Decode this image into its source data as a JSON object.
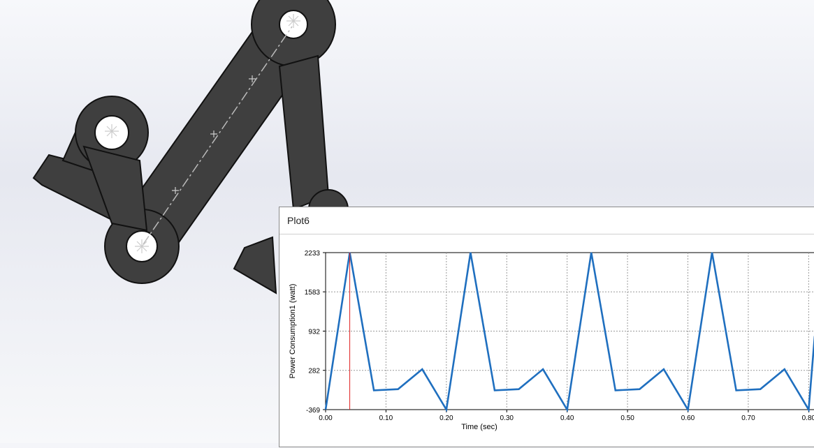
{
  "window": {
    "title": "Plot6"
  },
  "colors": {
    "series": "#1f6fbf",
    "cursor": "#e02020",
    "part": "#4a4a4a"
  },
  "chart_data": {
    "type": "line",
    "title": "",
    "xlabel": "Time (sec)",
    "ylabel": "Power Consumption1 (watt)",
    "xlim": [
      0.0,
      0.81
    ],
    "ylim": [
      -369,
      2233
    ],
    "yticks": [
      -369,
      282,
      932,
      1583,
      2233
    ],
    "xticks": [
      0.0,
      0.1,
      0.2,
      0.3,
      0.4,
      0.5,
      0.6,
      0.7,
      0.8
    ],
    "xtick_labels": [
      "0.00",
      "0.10",
      "0.20",
      "0.30",
      "0.40",
      "0.50",
      "0.60",
      "0.70",
      "0.80"
    ],
    "ytick_labels": [
      "-369",
      "282",
      "932",
      "1583",
      "2233"
    ],
    "grid": true,
    "cursor_x": 0.04,
    "series": [
      {
        "x": [
          0.0,
          0.04,
          0.08,
          0.12,
          0.16,
          0.2,
          0.24,
          0.28,
          0.32,
          0.36,
          0.4,
          0.44,
          0.48,
          0.52,
          0.56,
          0.6,
          0.64,
          0.68,
          0.72,
          0.76,
          0.8,
          0.81
        ],
        "values": [
          -369,
          2233,
          -50,
          -30,
          300,
          -369,
          2233,
          -50,
          -30,
          300,
          -369,
          2233,
          -50,
          -30,
          300,
          -369,
          2233,
          -50,
          -30,
          300,
          -369,
          850
        ]
      }
    ]
  }
}
